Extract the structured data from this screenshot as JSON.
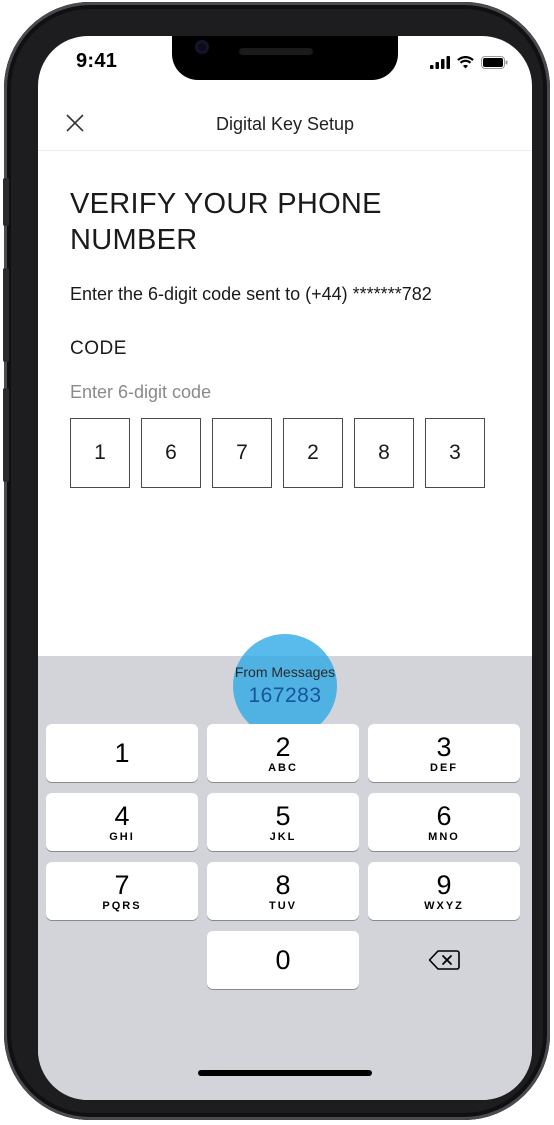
{
  "status_bar": {
    "time": "9:41"
  },
  "nav": {
    "title": "Digital Key Setup",
    "close_icon": "close-icon"
  },
  "content": {
    "heading": "VERIFY YOUR PHONE NUMBER",
    "subtext": "Enter the 6-digit code sent to (+44) *******782",
    "code_label": "CODE",
    "code_hint": "Enter 6-digit code",
    "code_digits": [
      "1",
      "6",
      "7",
      "2",
      "8",
      "3"
    ]
  },
  "keyboard": {
    "suggestion_source": "From Messages",
    "suggestion_code": "167283",
    "keys": [
      {
        "num": "1",
        "letters": ""
      },
      {
        "num": "2",
        "letters": "ABC"
      },
      {
        "num": "3",
        "letters": "DEF"
      },
      {
        "num": "4",
        "letters": "GHI"
      },
      {
        "num": "5",
        "letters": "JKL"
      },
      {
        "num": "6",
        "letters": "MNO"
      },
      {
        "num": "7",
        "letters": "PQRS"
      },
      {
        "num": "8",
        "letters": "TUV"
      },
      {
        "num": "9",
        "letters": "WXYZ"
      },
      {
        "num": "0",
        "letters": ""
      }
    ],
    "delete_icon": "backspace-icon"
  },
  "colors": {
    "suggestion_text": "#16559c",
    "touch_indicator": "#2aa8e6",
    "keyboard_bg": "#d2d4d9"
  }
}
